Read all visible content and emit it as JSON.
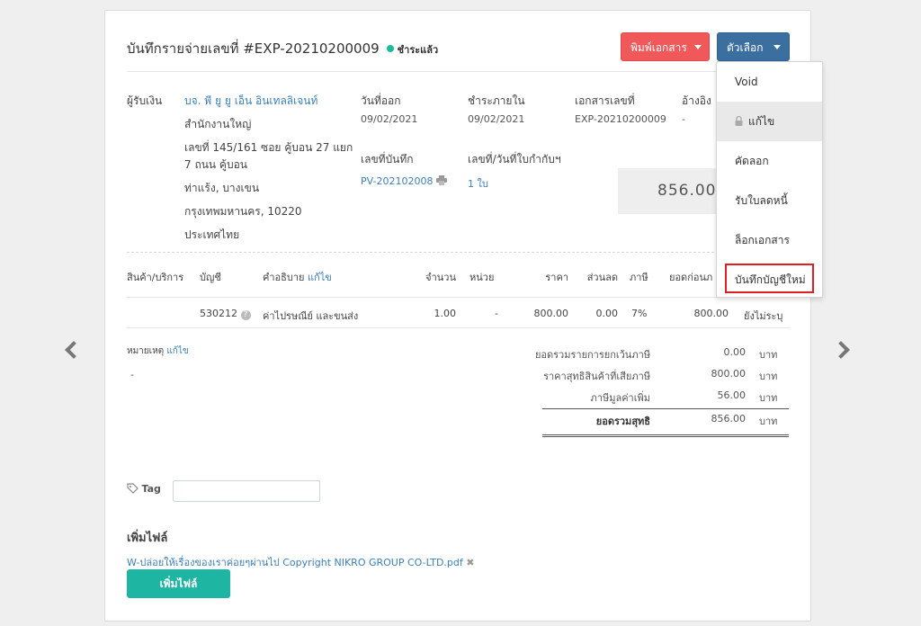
{
  "header": {
    "title": "บันทึกรายจ่ายเลขที่ #EXP-20210200009",
    "status": "ชำระแล้ว",
    "print_button": "พิมพ์เอกสาร",
    "options_button": "ตัวเลือก"
  },
  "options_menu": {
    "items": [
      "Void",
      "แก้ไข",
      "คัดลอก",
      "รับใบลดหนี้",
      "ล็อกเอกสาร",
      "บันทึกบัญชีใหม่"
    ]
  },
  "payee": {
    "label": "ผู้รับเงิน",
    "name": "บจ. พี ยู ยู เอ็น อินเทลลิเจนท์",
    "branch": "สำนักงานใหญ่",
    "address_line1": "เลขที่ 145/161 ซอย คู้บอน 27 แยก",
    "address_line2": "7 ถนน คู้บอน",
    "address_line3": "ท่าแร้ง, บางเขน",
    "address_line4": "กรุงเทพมหานคร, 10220",
    "country": "ประเทศไทย"
  },
  "info": {
    "issue_date_label": "วันที่ออก",
    "issue_date": "09/02/2021",
    "due_label": "ชำระภายใน",
    "due_date": "09/02/2021",
    "doc_no_label": "เอกสารเลขที่",
    "doc_no": "EXP-20210200009",
    "ref_label": "อ้างอิง",
    "ref_value": "-",
    "record_no_label": "เลขที่บันทึก",
    "record_no": "PV-202102008",
    "tax_invoice_label": "เลขที่/วันที่ใบกำกับฯ",
    "tax_invoice_value": "1 ใบ",
    "total_amount": "856.00"
  },
  "table": {
    "headers": {
      "product": "สินค้า/บริการ",
      "account": "บัญชี",
      "description": "คำอธิบาย",
      "description_edit": "แก้ไข",
      "qty": "จำนวน",
      "unit": "หน่วย",
      "price": "ราคา",
      "discount": "ส่วนลด",
      "vat": "ภาษี",
      "pre_tax": "ยอดก่อนภ"
    },
    "row": {
      "account": "530212",
      "description": "ค่าไปรษณีย์ และขนส่ง",
      "qty": "1.00",
      "unit": "-",
      "price": "800.00",
      "discount": "0.00",
      "vat": "7%",
      "pre_tax": "800.00",
      "extra": "ยังไม่ระบุ"
    }
  },
  "notes": {
    "label": "หมายเหตุ",
    "edit": "แก้ไข",
    "value": "-"
  },
  "summary": {
    "exempt_label": "ยอดรวมรายการยกเว้นภาษี",
    "exempt_value": "0.00",
    "taxable_label": "ราคาสุทธิสินค้าที่เสียภาษี",
    "taxable_value": "800.00",
    "vat_label": "ภาษีมูลค่าเพิ่ม",
    "vat_value": "56.00",
    "net_label": "ยอดรวมสุทธิ",
    "net_value": "856.00",
    "currency": "บาท"
  },
  "tag": {
    "label": "Tag"
  },
  "files": {
    "heading": "เพิ่มไฟล์",
    "file_name": "W-ปล่อยให้เรื่องของเราค่อยๆผ่านไป Copyright NIKRO GROUP CO-LTD.pdf",
    "add_button": "เพิ่มไฟล์"
  }
}
